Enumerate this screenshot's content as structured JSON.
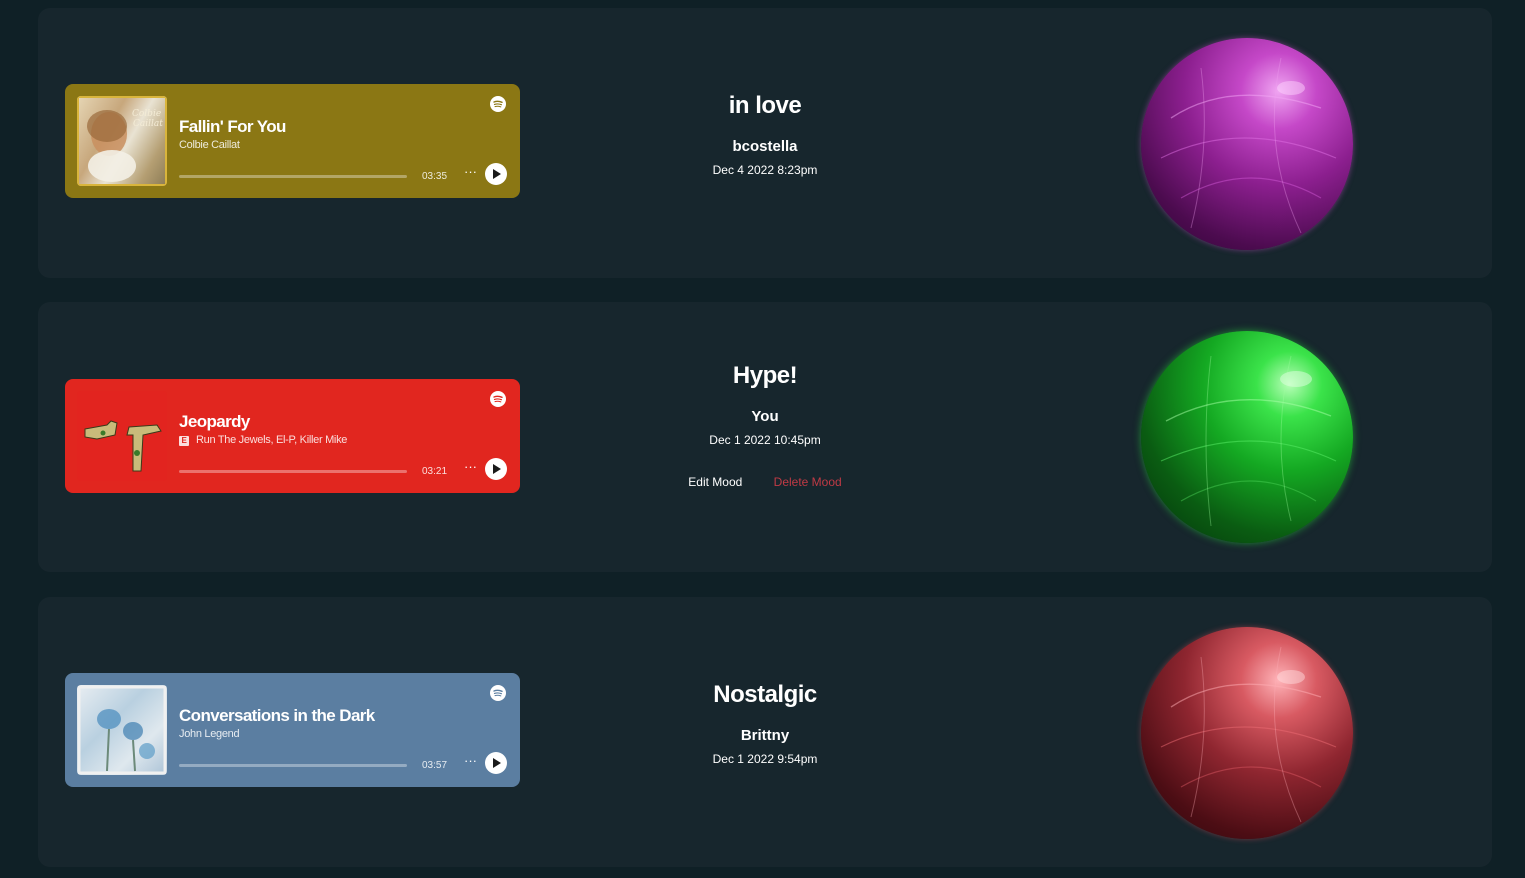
{
  "moods": [
    {
      "track": {
        "title": "Fallin' For You",
        "artist": "Colbie Caillat",
        "duration": "03:35",
        "explicit": false,
        "cover_text": "Colbie Caillat",
        "card_color": "#8b7714"
      },
      "mood": "in love",
      "user": "bcostella",
      "date": "Dec 4 2022 8:23pm",
      "orb_color": "#b235b6",
      "show_actions": false
    },
    {
      "track": {
        "title": "Jeopardy",
        "artist": "Run The Jewels, El-P, Killer Mike",
        "duration": "03:21",
        "explicit": true,
        "explicit_label": "E",
        "card_color": "#e1261f"
      },
      "mood": "Hype!",
      "user": "You",
      "date": "Dec 1 2022 10:45pm",
      "orb_color": "#17c42a",
      "show_actions": true,
      "edit_label": "Edit Mood",
      "delete_label": "Delete Mood"
    },
    {
      "track": {
        "title": "Conversations in the Dark",
        "artist": "John Legend",
        "duration": "03:57",
        "explicit": false,
        "card_color": "#5b7ea1"
      },
      "mood": "Nostalgic",
      "user": "Brittny",
      "date": "Dec 1 2022 9:54pm",
      "orb_color": "#c23b44",
      "show_actions": false
    }
  ],
  "player_controls": {
    "more_icon": "ellipsis-icon",
    "more_glyph": "···",
    "play_icon": "play-icon",
    "brand_icon": "spotify-icon"
  }
}
